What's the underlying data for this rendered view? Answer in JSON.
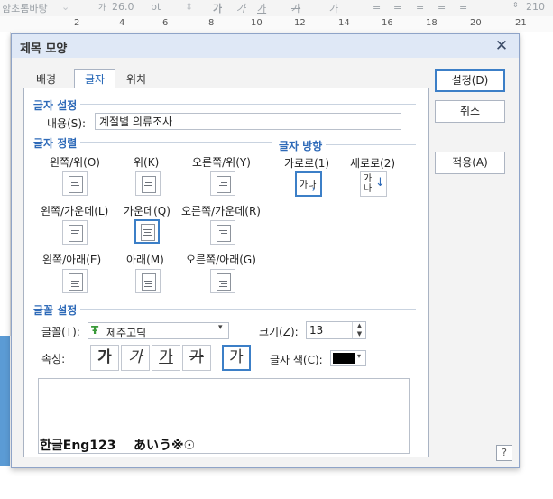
{
  "background": {
    "toolbar": {
      "font_face": "함초롬바탕",
      "font_size": "26.0",
      "size_unit": "pt",
      "partial_value": "210"
    },
    "ruler": {
      "ticks": [
        "2",
        "4",
        "6",
        "8",
        "10",
        "12",
        "14",
        "16",
        "18",
        "20",
        "21"
      ]
    }
  },
  "dialog": {
    "title": "제목 모양",
    "close_symbol": "✕",
    "tabs": [
      {
        "label": "배경"
      },
      {
        "label": "글자"
      },
      {
        "label": "위치"
      }
    ],
    "active_tab": "글자",
    "text_settings": {
      "section_label": "글자 설정",
      "content_label": "내용(S):",
      "content_value": "계절별 의류조사"
    },
    "alignment": {
      "section_label": "글자 정렬",
      "options": [
        {
          "label": "왼쪽/위(O)"
        },
        {
          "label": "위(K)"
        },
        {
          "label": "오른쪽/위(Y)"
        },
        {
          "label": "왼쪽/가운데(L)"
        },
        {
          "label": "가운데(Q)"
        },
        {
          "label": "오른쪽/가운데(R)"
        },
        {
          "label": "왼쪽/아래(E)"
        },
        {
          "label": "아래(M)"
        },
        {
          "label": "오른쪽/아래(G)"
        }
      ],
      "selected": "가운데(Q)"
    },
    "direction": {
      "section_label": "글자 방향",
      "options": [
        {
          "label": "가로로(1)",
          "icon_text": "가나"
        },
        {
          "label": "세로로(2)",
          "icon_text": "가나"
        }
      ],
      "selected": "가로로(1)"
    },
    "font_settings": {
      "section_label": "글꼴 설정",
      "font_label": "글꼴(T):",
      "font_value": "제주고딕",
      "font_icon_glyph": "Ŧ",
      "size_label": "크기(Z):",
      "size_value": "13",
      "attr_label": "속성:",
      "attributes": [
        {
          "name": "bold",
          "glyph": "가"
        },
        {
          "name": "italic",
          "glyph": "가"
        },
        {
          "name": "underline",
          "glyph": "가"
        },
        {
          "name": "strikethrough",
          "glyph": "가"
        },
        {
          "name": "normal",
          "glyph": "가"
        }
      ],
      "selected_attribute": "normal",
      "color_label": "글자 색(C):",
      "color_value": "#000000"
    },
    "preview_text": "한글Eng123    あいう※☉",
    "buttons": {
      "ok": "설정(D)",
      "cancel": "취소",
      "apply": "적용(A)",
      "help": "?"
    }
  }
}
